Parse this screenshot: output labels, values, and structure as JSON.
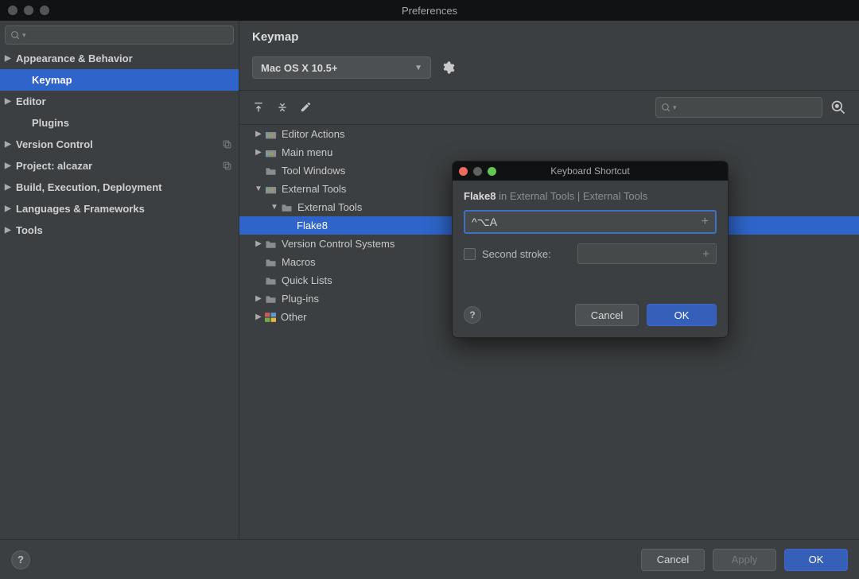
{
  "window": {
    "title": "Preferences"
  },
  "sidebar": {
    "items": [
      {
        "label": "Appearance & Behavior",
        "expandable": true
      },
      {
        "label": "Keymap",
        "selected": true,
        "child": true
      },
      {
        "label": "Editor",
        "expandable": true
      },
      {
        "label": "Plugins",
        "child": true
      },
      {
        "label": "Version Control",
        "expandable": true,
        "copy": true
      },
      {
        "label": "Project: alcazar",
        "expandable": true,
        "copy": true
      },
      {
        "label": "Build, Execution, Deployment",
        "expandable": true
      },
      {
        "label": "Languages & Frameworks",
        "expandable": true
      },
      {
        "label": "Tools",
        "expandable": true
      }
    ]
  },
  "content": {
    "title": "Keymap",
    "scheme": "Mac OS X 10.5+",
    "tree": [
      {
        "label": "Editor Actions",
        "indent": 1,
        "expandable": true,
        "icon": "toolbox"
      },
      {
        "label": "Main menu",
        "indent": 1,
        "expandable": true,
        "icon": "toolbox"
      },
      {
        "label": "Tool Windows",
        "indent": 1,
        "expandable": false,
        "icon": "folder"
      },
      {
        "label": "External Tools",
        "indent": 1,
        "expanded": true,
        "icon": "toolbox"
      },
      {
        "label": "External Tools",
        "indent": 2,
        "expanded": true,
        "icon": "folder"
      },
      {
        "label": "Flake8",
        "indent": 3,
        "selected": true
      },
      {
        "label": "Version Control Systems",
        "indent": 1,
        "expandable": true,
        "icon": "folder"
      },
      {
        "label": "Macros",
        "indent": 1,
        "icon": "folder"
      },
      {
        "label": "Quick Lists",
        "indent": 1,
        "icon": "folder"
      },
      {
        "label": "Plug-ins",
        "indent": 1,
        "expandable": true,
        "icon": "folder"
      },
      {
        "label": "Other",
        "indent": 1,
        "expandable": true,
        "icon": "colorbox"
      }
    ]
  },
  "modal": {
    "title": "Keyboard Shortcut",
    "crumb_action": "Flake8",
    "crumb_path": " in External Tools | External Tools",
    "shortcut": "^⌥A",
    "second_label": "Second stroke:",
    "cancel": "Cancel",
    "ok": "OK"
  },
  "footer": {
    "cancel": "Cancel",
    "apply": "Apply",
    "ok": "OK"
  }
}
